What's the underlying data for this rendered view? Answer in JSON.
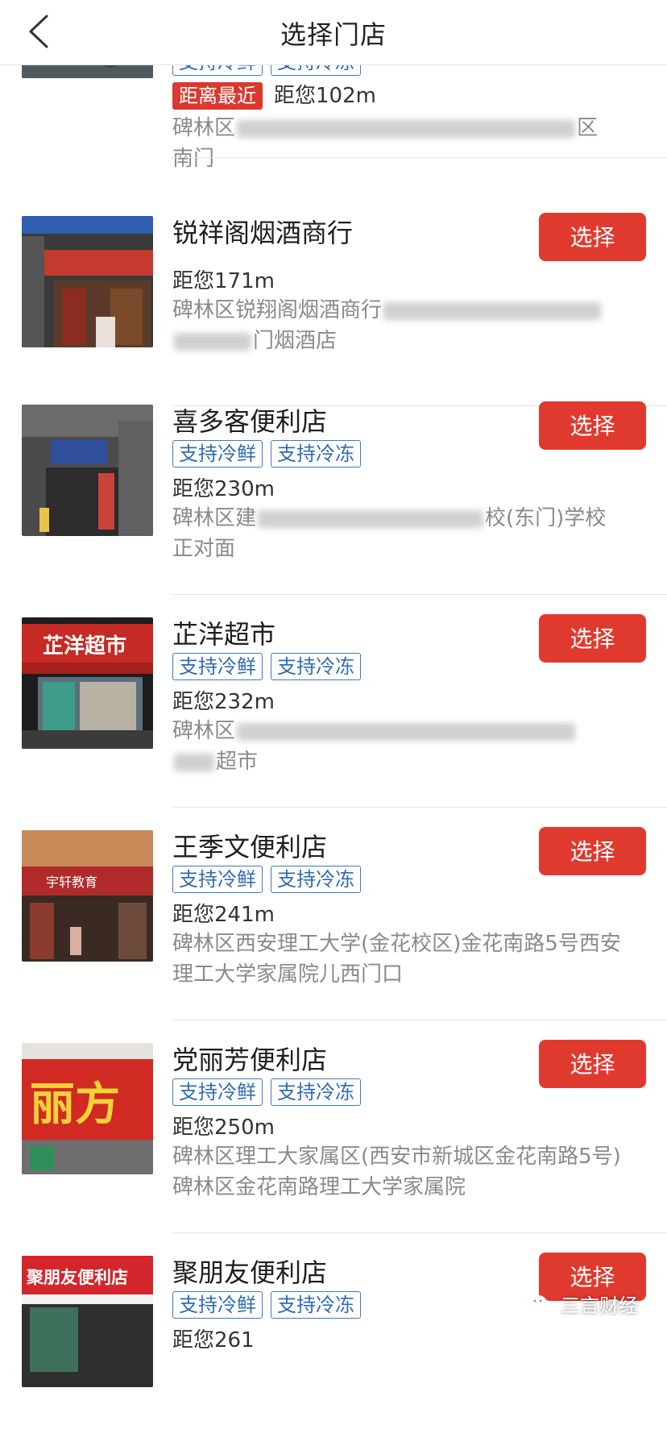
{
  "header": {
    "title": "选择门店"
  },
  "first_store": {
    "tags": [
      "支持冷鲜",
      "支持冷冻"
    ],
    "badge": "距离最近",
    "distance": "距您102m",
    "address_start": "碑林区",
    "address_end": "区",
    "address_line2": "南门"
  },
  "stores": [
    {
      "name": "锐祥阁烟酒商行",
      "tags": [],
      "distance": "距您171m",
      "address_start": "碑林区锐翔阁烟酒商行",
      "address_line2_end": "门烟酒店",
      "button": "选择"
    },
    {
      "name": "喜多客便利店",
      "tags": [
        "支持冷鲜",
        "支持冷冻"
      ],
      "distance": "距您230m",
      "address_start": "碑林区建",
      "address_end": "校(东门)学校",
      "address_line2": "正对面",
      "button": "选择"
    },
    {
      "name": "芷洋超市",
      "tags": [
        "支持冷鲜",
        "支持冷冻"
      ],
      "distance": "距您232m",
      "address_start": "碑林区",
      "address_line2_end": "超市",
      "button": "选择"
    },
    {
      "name": "王季文便利店",
      "tags": [
        "支持冷鲜",
        "支持冷冻"
      ],
      "distance": "距您241m",
      "address": "碑林区西安理工大学(金花校区)金花南路5号西安理工大学家属院儿西门口",
      "button": "选择"
    },
    {
      "name": "党丽芳便利店",
      "tags": [
        "支持冷鲜",
        "支持冷冻"
      ],
      "distance": "距您250m",
      "address": "碑林区理工大家属区(西安市新城区金花南路5号)碑林区金花南路理工大学家属院",
      "button": "选择"
    },
    {
      "name": "聚朋友便利店",
      "tags": [
        "支持冷鲜",
        "支持冷冻"
      ],
      "distance": "距您261",
      "button": "选择"
    }
  ],
  "thumb_signs": {
    "s3": "芷洋超市",
    "s4": "宇轩教育",
    "s5": "丽方",
    "s6": "聚朋友便利店"
  },
  "watermark": {
    "text": "三言财经"
  },
  "colors": {
    "accent": "#e03a2f",
    "tag": "#2f6bb8",
    "address": "#8a8a8a"
  }
}
